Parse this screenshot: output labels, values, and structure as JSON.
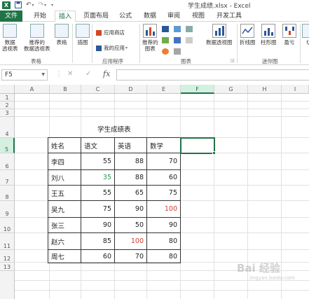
{
  "window": {
    "title": "学生成绩.xlsx - Excel"
  },
  "qat": {
    "logo": "X",
    "save_icon": "save-icon",
    "undo_icon": "undo-icon",
    "redo_icon": "redo-icon"
  },
  "tabs": [
    "文件",
    "开始",
    "插入",
    "页面布局",
    "公式",
    "数据",
    "审阅",
    "视图",
    "开发工具"
  ],
  "active_tab": "插入",
  "ribbon": {
    "groups": {
      "tables": "表格",
      "apps": "应用程序",
      "charts": "图表",
      "sparklines": "迷你图"
    },
    "buttons": {
      "pivot_table": "数据\n透视表",
      "recommended_pivot": "推荐的\n数据透视表",
      "table": "表格",
      "illustrations": "插图",
      "app_store": "应用商店",
      "my_apps": "我的应用",
      "recommended_charts": "推荐的\n图表",
      "pivot_chart": "数据透视图",
      "line": "折线图",
      "column": "柱形图",
      "win_loss": "盈亏",
      "slicer": "切"
    }
  },
  "formula_bar": {
    "name_box": "F5",
    "cancel": "✕",
    "enter": "✓",
    "fx": "fx",
    "value": ""
  },
  "columns": [
    "A",
    "B",
    "C",
    "D",
    "E",
    "F",
    "G",
    "H",
    "I"
  ],
  "rows": [
    "1",
    "2",
    "3",
    "4",
    "5",
    "6",
    "7",
    "8",
    "9",
    "10",
    "11",
    "12",
    "13"
  ],
  "selected_cell": {
    "column": "F",
    "row": "5"
  },
  "sheet": {
    "title": "学生成绩表",
    "headers": [
      "姓名",
      "语文",
      "英语",
      "数学"
    ],
    "records": [
      {
        "name": "李四",
        "chinese": "55",
        "english": "88",
        "math": "70",
        "highlight": ""
      },
      {
        "name": "刘八",
        "chinese": "35",
        "english": "88",
        "math": "60",
        "highlight": "chinese"
      },
      {
        "name": "王五",
        "chinese": "55",
        "english": "65",
        "math": "75",
        "highlight": ""
      },
      {
        "name": "吴九",
        "chinese": "75",
        "english": "90",
        "math": "100",
        "highlight": "math"
      },
      {
        "name": "张三",
        "chinese": "90",
        "english": "50",
        "math": "90",
        "highlight": ""
      },
      {
        "name": "赵六",
        "chinese": "85",
        "english": "100",
        "math": "80",
        "highlight": "english"
      },
      {
        "name": "周七",
        "chinese": "60",
        "english": "70",
        "math": "80",
        "highlight": ""
      }
    ]
  },
  "colors": {
    "excel_green": "#217346",
    "low_score": "#2e9b56",
    "high_score": "#d13c2e"
  },
  "watermark": {
    "main": "Bai 经验",
    "sub": "jingyan.baidu.com"
  }
}
